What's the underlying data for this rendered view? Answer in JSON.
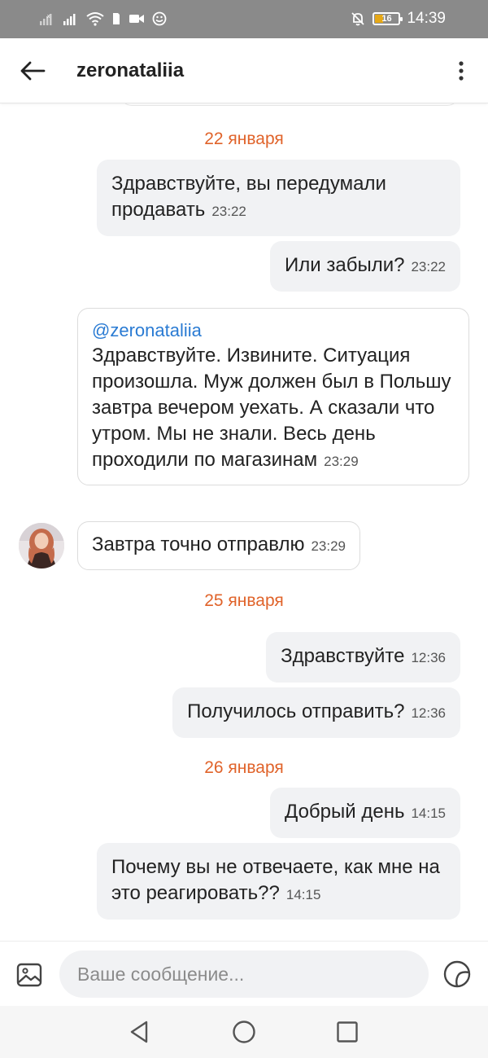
{
  "status_bar": {
    "time": "14:39",
    "battery": "16",
    "battery_level": 0.16,
    "left_icons": [
      "no-sim-signal-icon",
      "signal-icon",
      "wifi-icon",
      "sim-icon",
      "video-call-icon",
      "emoji-notification-icon"
    ],
    "right_icons": [
      "bell-off-icon",
      "battery-icon"
    ]
  },
  "header": {
    "title": "zeronataliia",
    "back_icon": "arrow-left-icon",
    "menu_icon": "more-vertical-icon"
  },
  "messages": [
    {
      "type": "date",
      "text": "22 января"
    },
    {
      "type": "outgoing",
      "text": "Здравствуйте, вы передумали продавать",
      "time": "23:22"
    },
    {
      "type": "outgoing",
      "text": "Или забыли?",
      "time": "23:22"
    },
    {
      "type": "incoming",
      "mention": "@zeronataliia",
      "text": "Здравствуйте. Извините. Ситуация произошла. Муж должен был в Польшу завтра вечером уехать. А сказали что утром. Мы не знали. Весь  день проходили по магазинам",
      "time": "23:29"
    },
    {
      "type": "incoming",
      "text": "Завтра точно отправлю",
      "time": "23:29"
    },
    {
      "type": "date",
      "text": "25 января"
    },
    {
      "type": "outgoing",
      "text": "Здравствуйте",
      "time": "12:36"
    },
    {
      "type": "outgoing",
      "text": "Получилось отправить?",
      "time": "12:36"
    },
    {
      "type": "date",
      "text": "26 января"
    },
    {
      "type": "outgoing",
      "text": "Добрый день",
      "time": "14:15"
    },
    {
      "type": "outgoing",
      "text": "Почему вы не отвечаете, как мне на это реагировать??",
      "time": "14:15"
    }
  ],
  "composer": {
    "placeholder": "Ваше сообщение...",
    "attach_icon": "image-icon",
    "sticker_icon": "sticker-icon"
  },
  "nav_bar": {
    "icons": [
      "back-triangle-icon",
      "home-circle-icon",
      "recents-square-icon"
    ]
  },
  "colors": {
    "accent_date": "#e0632a",
    "mention": "#2a7bd3",
    "outgoing_bubble": "#f1f2f4",
    "status_bar": "#8a8a8a",
    "battery_low": "#e6a817"
  }
}
